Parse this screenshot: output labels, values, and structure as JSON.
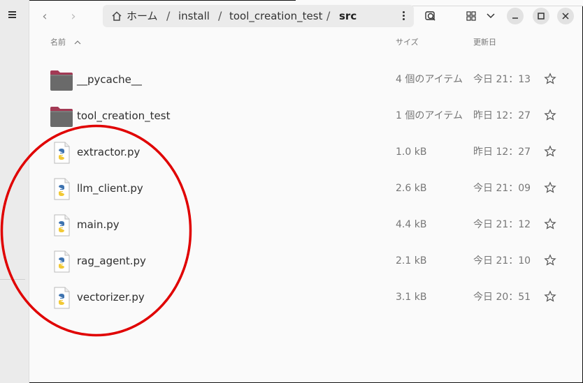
{
  "pathbar": {
    "home_label": "ホーム",
    "crumbs": [
      "install",
      "tool_creation_test",
      "src"
    ],
    "separator": "/"
  },
  "columns": {
    "name": "名前",
    "size": "サイズ",
    "modified": "更新日"
  },
  "files": [
    {
      "name": "__pycache__",
      "type": "folder",
      "size": "4 個のアイテム",
      "modified": "今日 21：13"
    },
    {
      "name": "tool_creation_test",
      "type": "folder",
      "size": "1 個のアイテム",
      "modified": "昨日 12：27"
    },
    {
      "name": "extractor.py",
      "type": "python",
      "size": "1.0 kB",
      "modified": "昨日 12：27"
    },
    {
      "name": "llm_client.py",
      "type": "python",
      "size": "2.6 kB",
      "modified": "今日 21：09"
    },
    {
      "name": "main.py",
      "type": "python",
      "size": "4.4 kB",
      "modified": "今日 21：12"
    },
    {
      "name": "rag_agent.py",
      "type": "python",
      "size": "2.1 kB",
      "modified": "今日 21：10"
    },
    {
      "name": "vectorizer.py",
      "type": "python",
      "size": "3.1 kB",
      "modified": "今日 20：51"
    }
  ],
  "icons": {
    "nav_back": "‹",
    "nav_forward": "›",
    "menu": "hamburger-icon",
    "search": "search-icon",
    "view": "grid-view-icon",
    "dropdown": "chevron-down-icon",
    "minimize": "minimize-icon",
    "maximize": "maximize-icon",
    "close": "close-icon",
    "star": "star-icon",
    "sort": "sort-ascending-icon"
  },
  "colors": {
    "annotation_ring": "#e00000",
    "folder": "#6a6a6a",
    "folder_tab": "#a33a55"
  }
}
